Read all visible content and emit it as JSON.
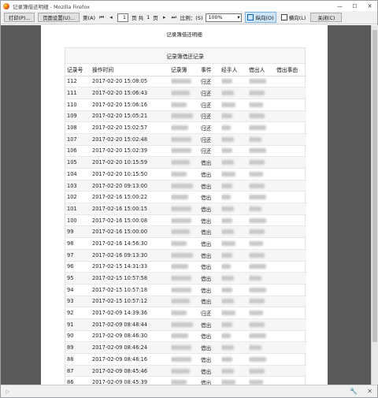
{
  "window": {
    "title": "记录簿借还明细 - Mozilla Firefox",
    "min_label": "—",
    "max_label": "☐",
    "close_label": "✕"
  },
  "toolbar": {
    "print_label": "打印(P)...",
    "page_setup_label": "页面设置(U)...",
    "page_label": "第(A)",
    "first_glyph": "⏮",
    "prev_glyph": "◂",
    "current_page": "1",
    "total_prefix": "页 共",
    "total_pages": "1",
    "total_suffix": "页",
    "scale_label": "比例：(S)",
    "scale_value": "100%",
    "portrait_label": "纵向(O)",
    "landscape_label": "横向(L)",
    "close_label": "关闭(C)"
  },
  "page": {
    "header": "记录簿借还明细"
  },
  "report": {
    "title": "记录簿借还记录",
    "columns": [
      "记录号",
      "操作时间",
      "记录簿",
      "事件",
      "经手人",
      "借出人",
      "借出事由"
    ],
    "rows": [
      {
        "id": "112",
        "time": "2017-02-20 15:08:05",
        "event": "归还"
      },
      {
        "id": "111",
        "time": "2017-02-20 15:06:43",
        "event": "归还"
      },
      {
        "id": "110",
        "time": "2017-02-20 15:06:16",
        "event": "归还"
      },
      {
        "id": "109",
        "time": "2017-02-20 15:05:21",
        "event": "归还"
      },
      {
        "id": "108",
        "time": "2017-02-20 15:02:57",
        "event": "归还"
      },
      {
        "id": "107",
        "time": "2017-02-20 15:02:48",
        "event": "归还"
      },
      {
        "id": "106",
        "time": "2017-02-20 15:02:39",
        "event": "归还"
      },
      {
        "id": "105",
        "time": "2017-02-20 10:15:59",
        "event": "借出"
      },
      {
        "id": "104",
        "time": "2017-02-20 10:15:50",
        "event": "借出"
      },
      {
        "id": "103",
        "time": "2017-02-20 09:13:00",
        "event": "借出"
      },
      {
        "id": "102",
        "time": "2017-02-16 15:00:22",
        "event": "借出"
      },
      {
        "id": "101",
        "time": "2017-02-16 15:00:15",
        "event": "借出"
      },
      {
        "id": "100",
        "time": "2017-02-16 15:00:08",
        "event": "借出"
      },
      {
        "id": "99",
        "time": "2017-02-16 15:00:00",
        "event": "借出"
      },
      {
        "id": "98",
        "time": "2017-02-16 14:56:30",
        "event": "借出"
      },
      {
        "id": "97",
        "time": "2017-02-16 09:13:30",
        "event": "借出"
      },
      {
        "id": "96",
        "time": "2017-02-15 14:31:33",
        "event": "借出"
      },
      {
        "id": "95",
        "time": "2017-02-15 10:57:58",
        "event": "借出"
      },
      {
        "id": "94",
        "time": "2017-02-15 10:57:18",
        "event": "借出"
      },
      {
        "id": "93",
        "time": "2017-02-15 10:57:12",
        "event": "借出"
      },
      {
        "id": "92",
        "time": "2017-02-09 14:39:36",
        "event": "归还"
      },
      {
        "id": "91",
        "time": "2017-02-09 08:48:44",
        "event": "借出"
      },
      {
        "id": "90",
        "time": "2017-02-09 08:46:30",
        "event": "借出"
      },
      {
        "id": "89",
        "time": "2017-02-09 08:46:24",
        "event": "借出"
      },
      {
        "id": "88",
        "time": "2017-02-09 08:46:16",
        "event": "借出"
      },
      {
        "id": "87",
        "time": "2017-02-09 08:45:46",
        "event": "借出"
      },
      {
        "id": "86",
        "time": "2017-02-09 08:45:39",
        "event": "借出"
      }
    ]
  }
}
